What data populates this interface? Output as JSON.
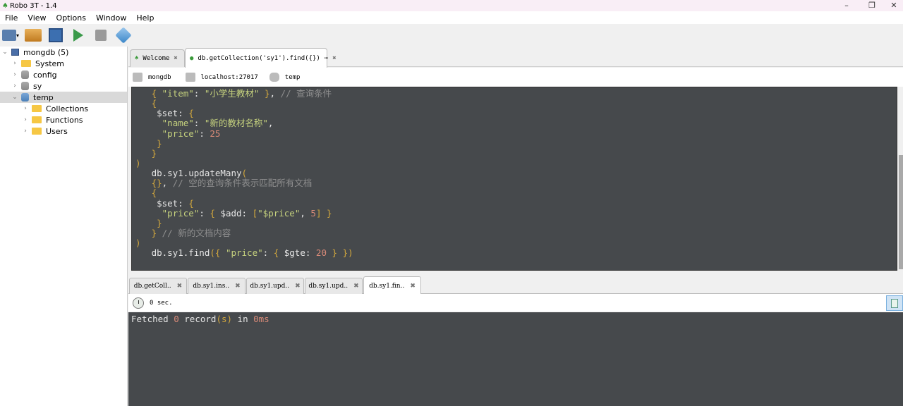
{
  "window": {
    "title": "Robo 3T - 1.4",
    "minimize": "–",
    "restore": "❐",
    "close": "✕"
  },
  "menu": [
    "File",
    "View",
    "Options",
    "Window",
    "Help"
  ],
  "tree": {
    "root": "mongdb (5)",
    "items": [
      {
        "label": "System",
        "type": "folder"
      },
      {
        "label": "config",
        "type": "db"
      },
      {
        "label": "sy",
        "type": "db"
      },
      {
        "label": "temp",
        "type": "db",
        "selected": true
      }
    ],
    "children": [
      "Collections",
      "Functions",
      "Users"
    ]
  },
  "tabs": [
    {
      "label": "Welcome"
    },
    {
      "label": "db.getCollection('sy1').find({})",
      "more": "⋯",
      "active": true
    }
  ],
  "info": {
    "connection": "mongdb",
    "host": "localhost:27017",
    "database": "temp"
  },
  "code": [
    [
      [
        "p",
        "   "
      ],
      [
        "b",
        "{"
      ],
      [
        "p",
        " "
      ],
      [
        "k",
        "\"item\""
      ],
      [
        "p",
        ": "
      ],
      [
        "k",
        "\"小学生教材\""
      ],
      [
        "p",
        " "
      ],
      [
        "b",
        "}"
      ],
      [
        "p",
        ", "
      ],
      [
        "c",
        "// 查询条件"
      ]
    ],
    [
      [
        "p",
        "   "
      ],
      [
        "b",
        "{"
      ]
    ],
    [
      [
        "p",
        "    $set: "
      ],
      [
        "b",
        "{"
      ]
    ],
    [
      [
        "p",
        "     "
      ],
      [
        "k",
        "\"name\""
      ],
      [
        "p",
        ": "
      ],
      [
        "k",
        "\"新的教材名称\""
      ],
      [
        "p",
        ","
      ]
    ],
    [
      [
        "p",
        "     "
      ],
      [
        "k",
        "\"price\""
      ],
      [
        "p",
        ": "
      ],
      [
        "n",
        "25"
      ]
    ],
    [
      [
        "p",
        "    "
      ],
      [
        "b",
        "}"
      ]
    ],
    [
      [
        "p",
        "   "
      ],
      [
        "b",
        "}"
      ]
    ],
    [
      [
        "b",
        ")"
      ]
    ],
    [
      [
        "p",
        "   db.sy1.updateMany"
      ],
      [
        "b",
        "("
      ]
    ],
    [
      [
        "p",
        "   "
      ],
      [
        "b",
        "{}"
      ],
      [
        "p",
        ", "
      ],
      [
        "c",
        "// 空的查询条件表示匹配所有文档"
      ]
    ],
    [
      [
        "p",
        "   "
      ],
      [
        "b",
        "{"
      ]
    ],
    [
      [
        "p",
        "    $set: "
      ],
      [
        "b",
        "{"
      ]
    ],
    [
      [
        "p",
        "     "
      ],
      [
        "k",
        "\"price\""
      ],
      [
        "p",
        ": "
      ],
      [
        "b",
        "{"
      ],
      [
        "p",
        " $add: "
      ],
      [
        "b",
        "["
      ],
      [
        "k",
        "\"$price\""
      ],
      [
        "p",
        ", "
      ],
      [
        "n",
        "5"
      ],
      [
        "b",
        "]"
      ],
      [
        "p",
        " "
      ],
      [
        "b",
        "}"
      ]
    ],
    [
      [
        "p",
        "    "
      ],
      [
        "b",
        "}"
      ]
    ],
    [
      [
        "p",
        "   "
      ],
      [
        "b",
        "}"
      ],
      [
        "p",
        " "
      ],
      [
        "c",
        "// 新的文档内容"
      ]
    ],
    [
      [
        "b",
        ")"
      ]
    ],
    [
      [
        "p",
        "   db.sy1.find"
      ],
      [
        "b",
        "({"
      ],
      [
        "p",
        " "
      ],
      [
        "k",
        "\"price\""
      ],
      [
        "p",
        ": "
      ],
      [
        "b",
        "{"
      ],
      [
        "p",
        " $gte: "
      ],
      [
        "n",
        "20"
      ],
      [
        "p",
        " "
      ],
      [
        "b",
        "}"
      ],
      [
        "p",
        " "
      ],
      [
        "b",
        "})"
      ]
    ]
  ],
  "result_tabs": [
    "db.getColl..",
    "db.sy1.ins..",
    "db.sy1.upd..",
    "db.sy1.upd..",
    "db.sy1.fin.."
  ],
  "status": {
    "time": "0 sec."
  },
  "output": [
    [
      "p",
      "Fetched "
    ],
    [
      "n",
      "0"
    ],
    [
      "p",
      " record"
    ],
    [
      "b",
      "(s)"
    ],
    [
      "p",
      " in "
    ],
    [
      "n",
      "0ms"
    ]
  ]
}
